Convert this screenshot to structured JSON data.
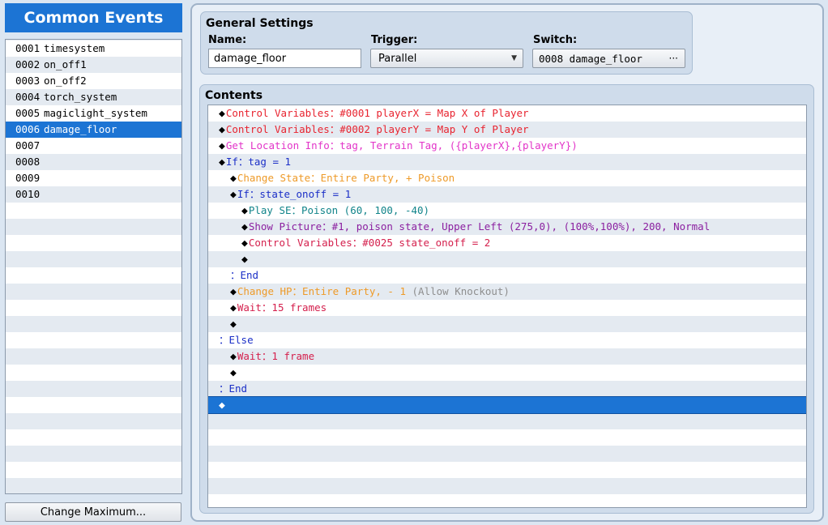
{
  "common_events": {
    "title": "Common Events",
    "items": [
      {
        "num": "0001",
        "name": "timesystem",
        "selected": false
      },
      {
        "num": "0002",
        "name": "on_off1",
        "selected": false
      },
      {
        "num": "0003",
        "name": "on_off2",
        "selected": false
      },
      {
        "num": "0004",
        "name": "torch_system",
        "selected": false
      },
      {
        "num": "0005",
        "name": "magiclight_system",
        "selected": false
      },
      {
        "num": "0006",
        "name": "damage_floor",
        "selected": true
      },
      {
        "num": "0007",
        "name": "",
        "selected": false
      },
      {
        "num": "0008",
        "name": "",
        "selected": false
      },
      {
        "num": "0009",
        "name": "",
        "selected": false
      },
      {
        "num": "0010",
        "name": "",
        "selected": false
      }
    ],
    "change_maximum_label": "Change Maximum..."
  },
  "general": {
    "title": "General Settings",
    "name_label": "Name:",
    "name_value": "damage_floor",
    "trigger_label": "Trigger:",
    "trigger_value": "Parallel",
    "switch_label": "Switch:",
    "switch_value": "0008 damage_floor",
    "switch_button": "···"
  },
  "contents": {
    "title": "Contents",
    "commands": [
      {
        "indent": 0,
        "marker": "◆",
        "parts": [
          {
            "t": "Control Variables：#0001 playerX = Map X of Player",
            "c": "red"
          }
        ]
      },
      {
        "indent": 0,
        "marker": "◆",
        "parts": [
          {
            "t": "Control Variables：#0002 playerY = Map Y of Player",
            "c": "red"
          }
        ]
      },
      {
        "indent": 0,
        "marker": "◆",
        "parts": [
          {
            "t": "Get Location Info：tag, Terrain Tag, ({playerX},{playerY})",
            "c": "pink"
          }
        ]
      },
      {
        "indent": 0,
        "marker": "◆",
        "parts": [
          {
            "t": "If：tag = 1",
            "c": "blue"
          }
        ]
      },
      {
        "indent": 1,
        "marker": "◆",
        "parts": [
          {
            "t": "Change State：Entire Party, + Poison",
            "c": "orange"
          }
        ]
      },
      {
        "indent": 1,
        "marker": "◆",
        "parts": [
          {
            "t": "If：state_onoff = 1",
            "c": "blue"
          }
        ]
      },
      {
        "indent": 2,
        "marker": "◆",
        "parts": [
          {
            "t": "Play SE：Poison (60, 100, -40)",
            "c": "teal"
          }
        ]
      },
      {
        "indent": 2,
        "marker": "◆",
        "parts": [
          {
            "t": "Show Picture：#1, poison state, Upper Left (275,0), (100%,100%), 200, Normal",
            "c": "purple"
          }
        ]
      },
      {
        "indent": 2,
        "marker": "◆",
        "parts": [
          {
            "t": "Control Variables：#0025 state_onoff = 2",
            "c": "crimson"
          }
        ]
      },
      {
        "indent": 2,
        "marker": "◆",
        "parts": []
      },
      {
        "indent": 1,
        "marker": "",
        "parts": [
          {
            "t": "：End",
            "c": "blue"
          }
        ]
      },
      {
        "indent": 1,
        "marker": "◆",
        "parts": [
          {
            "t": "Change HP：Entire Party, - 1 ",
            "c": "orange"
          },
          {
            "t": "(Allow Knockout)",
            "c": "gray"
          }
        ]
      },
      {
        "indent": 1,
        "marker": "◆",
        "parts": [
          {
            "t": "Wait：15 frames",
            "c": "crimson"
          }
        ]
      },
      {
        "indent": 1,
        "marker": "◆",
        "parts": []
      },
      {
        "indent": 0,
        "marker": "",
        "parts": [
          {
            "t": "：Else",
            "c": "blue"
          }
        ]
      },
      {
        "indent": 1,
        "marker": "◆",
        "parts": [
          {
            "t": "Wait：1 frame",
            "c": "crimson"
          }
        ]
      },
      {
        "indent": 1,
        "marker": "◆",
        "parts": []
      },
      {
        "indent": 0,
        "marker": "",
        "parts": [
          {
            "t": "：End",
            "c": "blue"
          }
        ]
      },
      {
        "indent": 0,
        "marker": "◆",
        "parts": [],
        "selected": true
      }
    ]
  }
}
